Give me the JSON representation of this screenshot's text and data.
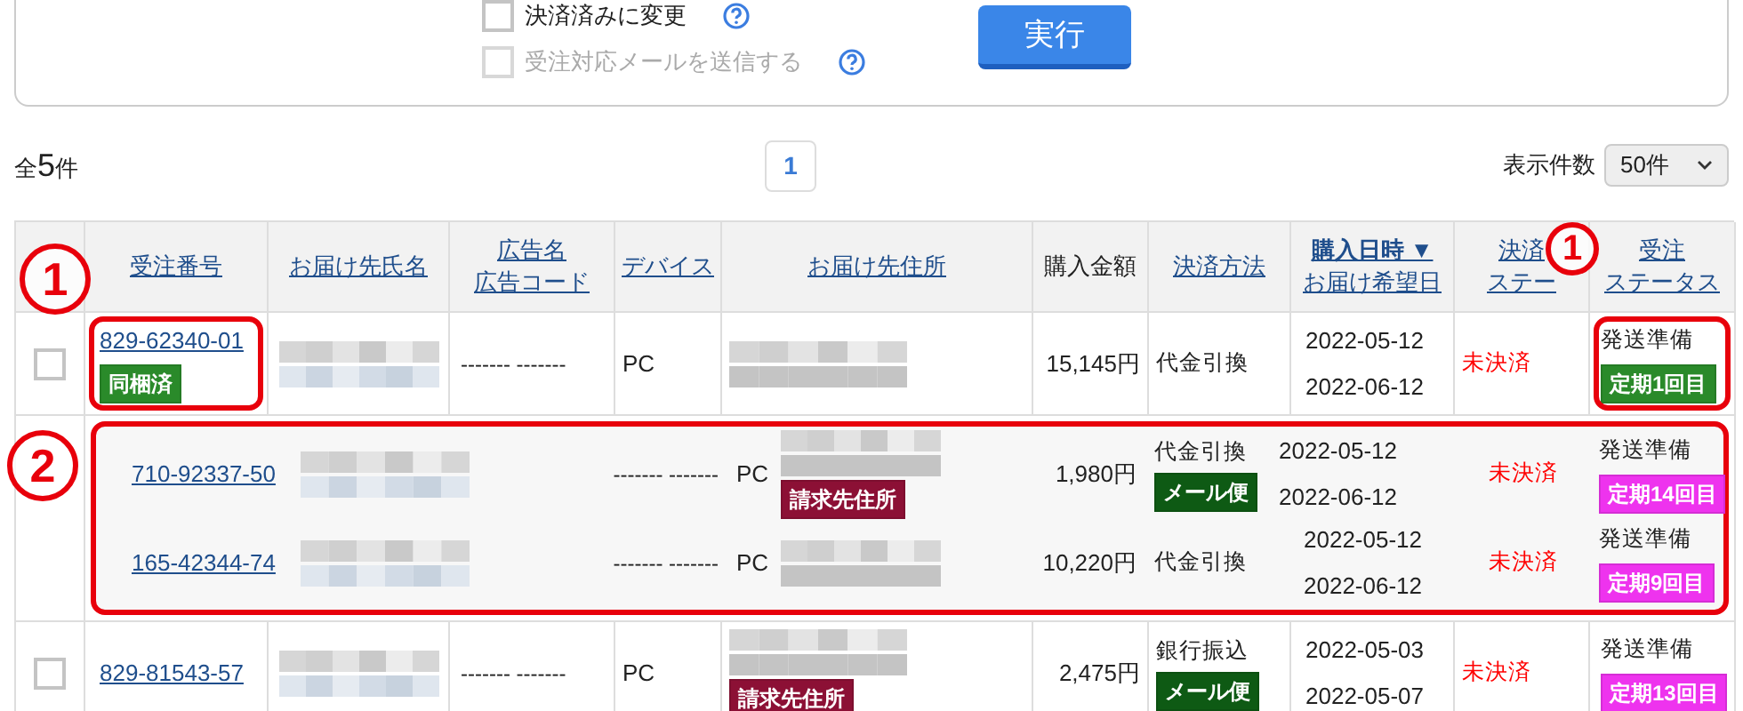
{
  "actions": {
    "options": [
      {
        "label": "決済済みに変更",
        "checked": false,
        "disabled": false
      },
      {
        "label": "受注対応メールを送信する",
        "checked": false,
        "disabled": true
      }
    ],
    "button": "実行"
  },
  "summary": {
    "prefix": "全",
    "count": "5",
    "suffix": "件"
  },
  "pagination": [
    {
      "label": "1",
      "selected": true
    }
  ],
  "page_size": {
    "label": "表示件数",
    "value": "50件"
  },
  "table": {
    "columns": [
      {
        "lines": [
          "受注番号"
        ],
        "kind": "link"
      },
      {
        "lines": [
          "お届け先氏名"
        ],
        "kind": "link"
      },
      {
        "lines": [
          "広告名",
          "広告コード"
        ],
        "kind": "link"
      },
      {
        "lines": [
          "デバイス"
        ],
        "kind": "link"
      },
      {
        "lines": [
          "お届け先住所"
        ],
        "kind": "link"
      },
      {
        "lines": [
          "購入金額"
        ],
        "kind": "plain"
      },
      {
        "lines": [
          "決済方法"
        ],
        "kind": "link"
      },
      {
        "lines": [
          "購入日時 ▼",
          "お届け希望日"
        ],
        "kind": "sorted"
      },
      {
        "lines": [
          "決済",
          "ステー"
        ],
        "kind": "link"
      },
      {
        "lines": [
          "受注",
          "ステータス"
        ],
        "kind": "link"
      }
    ],
    "rows": [
      {
        "kind": "order",
        "checked": false,
        "highlighted": true,
        "order_no": "829-62340-01",
        "order_tag": "同梱済",
        "name_redacted": true,
        "ad": "------- -------",
        "device": "PC",
        "address_redacted": true,
        "amount": "15,145円",
        "payment": "代金引換",
        "purchase_date": "2022-05-12",
        "delivery_date": "2022-06-12",
        "payment_status": "未決済",
        "order_status": "発送準備",
        "status_tag": {
          "label": "定期1回目",
          "color": "#2a8a2a"
        }
      },
      {
        "kind": "bundle",
        "items": [
          {
            "order_no": "710-92337-50",
            "name_redacted": true,
            "ad": "------- -------",
            "device": "PC",
            "address_redacted": true,
            "address_tag": "請求先住所",
            "amount": "1,980円",
            "payment": "代金引換",
            "payment_tag": "メール便",
            "purchase_date": "2022-05-12",
            "delivery_date": "2022-06-12",
            "payment_status": "未決済",
            "order_status": "発送準備",
            "status_tag": {
              "label": "定期14回目",
              "color": "#ee33ee"
            }
          },
          {
            "order_no": "165-42344-74",
            "name_redacted": true,
            "ad": "------- -------",
            "device": "PC",
            "address_redacted": true,
            "amount": "10,220円",
            "payment": "代金引換",
            "purchase_date": "2022-05-12",
            "delivery_date": "2022-06-12",
            "payment_status": "未決済",
            "order_status": "発送準備",
            "status_tag": {
              "label": "定期9回目",
              "color": "#ee33ee"
            }
          }
        ]
      },
      {
        "kind": "order",
        "checked": false,
        "highlighted": false,
        "order_no": "829-81543-57",
        "name_redacted": true,
        "ad": "------- -------",
        "device": "PC",
        "address_redacted": true,
        "address_tag": "請求先住所",
        "amount": "2,475円",
        "payment": "銀行振込",
        "payment_tag": "メール便",
        "purchase_date": "2022-05-03",
        "delivery_date": "2022-05-07",
        "payment_status": "未決済",
        "order_status": "発送準備",
        "status_tag": {
          "label": "定期13回目",
          "color": "#ee33ee"
        }
      }
    ]
  },
  "annotations": [
    {
      "label": "1"
    },
    {
      "label": "1"
    },
    {
      "label": "2"
    }
  ]
}
